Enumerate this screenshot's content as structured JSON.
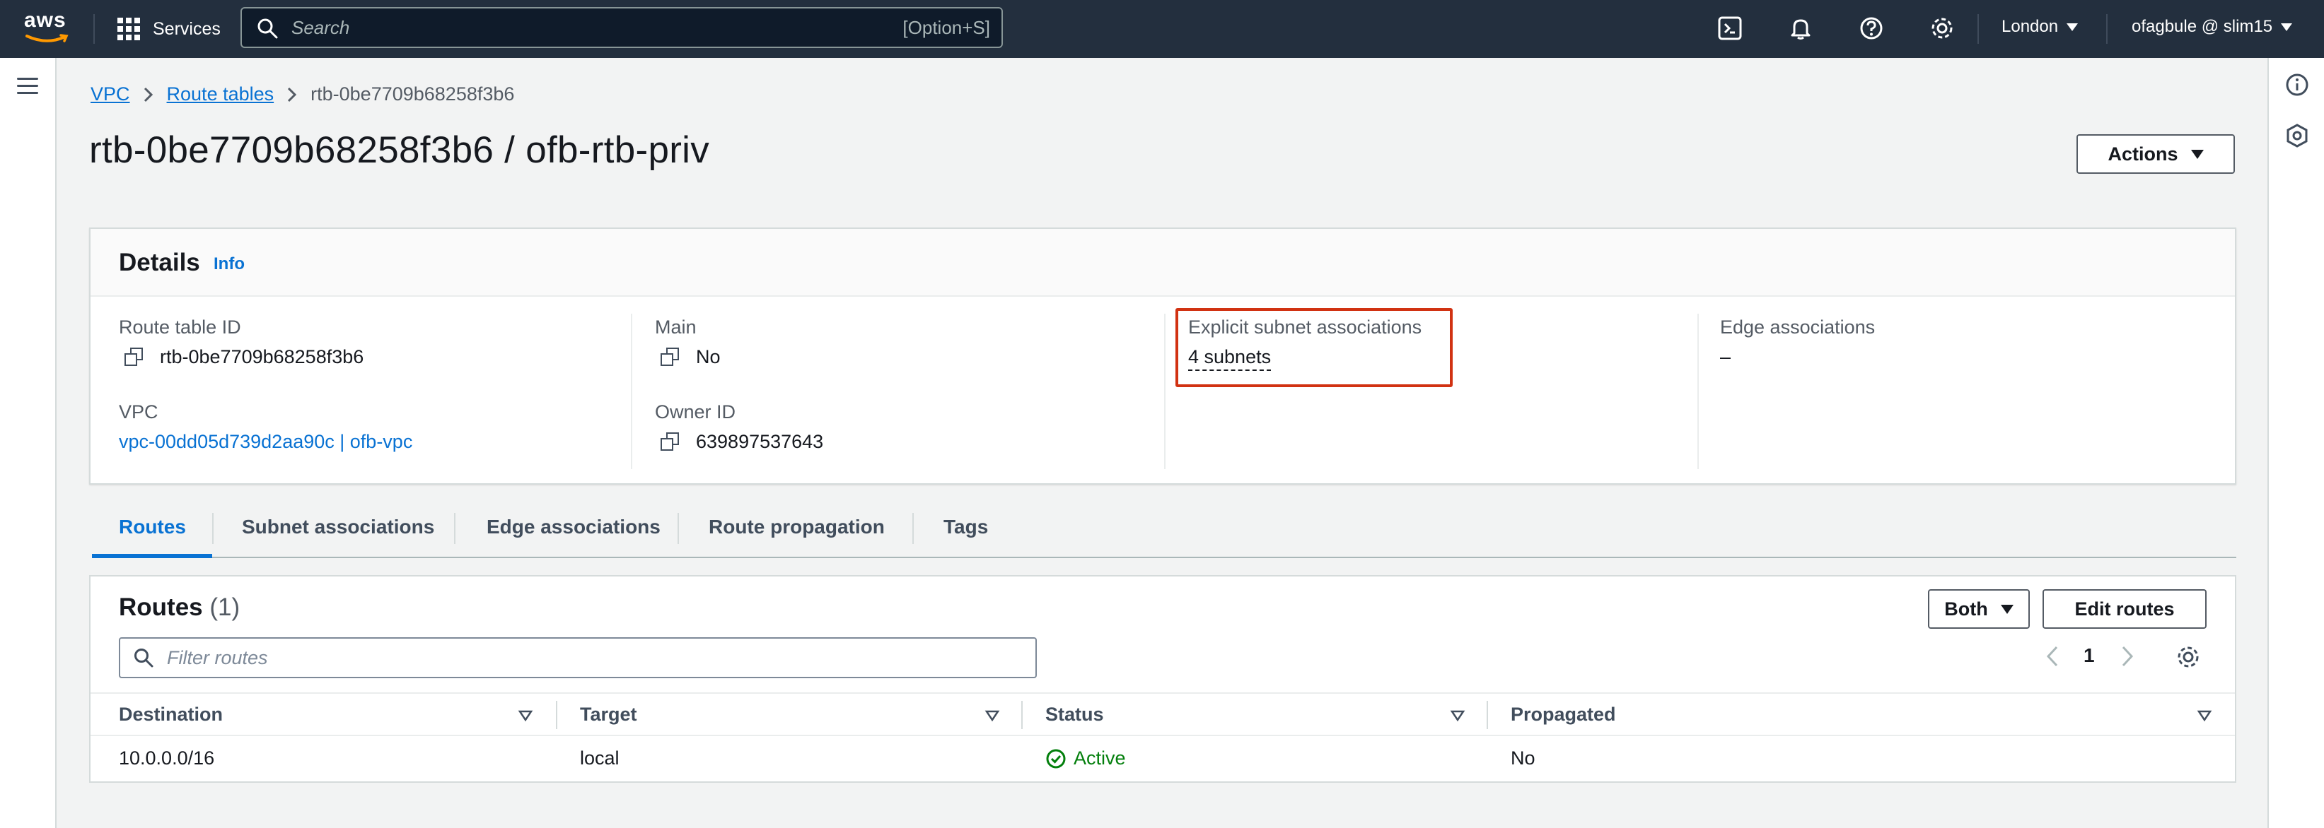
{
  "topnav": {
    "logo_text": "aws",
    "services_label": "Services",
    "search_placeholder": "Search",
    "search_shortcut": "[Option+S]",
    "region": "London",
    "account": "ofagbule @ slim15"
  },
  "breadcrumb": {
    "items": [
      "VPC",
      "Route tables"
    ],
    "current": "rtb-0be7709b68258f3b6"
  },
  "page_title": "rtb-0be7709b68258f3b6 / ofb-rtb-priv",
  "actions_label": "Actions",
  "details": {
    "title": "Details",
    "info_label": "Info",
    "route_table_id_label": "Route table ID",
    "route_table_id": "rtb-0be7709b68258f3b6",
    "vpc_label": "VPC",
    "vpc_value": "vpc-00dd05d739d2aa90c | ofb-vpc",
    "main_label": "Main",
    "main_value": "No",
    "owner_id_label": "Owner ID",
    "owner_id": "639897537643",
    "explicit_label": "Explicit subnet associations",
    "explicit_value": "4 subnets",
    "edge_label": "Edge associations",
    "edge_value": "–"
  },
  "tabs": [
    {
      "label": "Routes",
      "active": true
    },
    {
      "label": "Subnet associations",
      "active": false
    },
    {
      "label": "Edge associations",
      "active": false
    },
    {
      "label": "Route propagation",
      "active": false
    },
    {
      "label": "Tags",
      "active": false
    }
  ],
  "routes": {
    "title": "Routes",
    "count": "(1)",
    "filter_placeholder": "Filter routes",
    "view_select": "Both",
    "edit_label": "Edit routes",
    "page": "1",
    "columns": [
      "Destination",
      "Target",
      "Status",
      "Propagated"
    ],
    "rows": [
      {
        "destination": "10.0.0.0/16",
        "target": "local",
        "status": "Active",
        "propagated": "No"
      }
    ]
  },
  "colors": {
    "nav_bg": "#232f3e",
    "link": "#0972d3",
    "highlight": "#d13212",
    "status_ok": "#037f0c"
  }
}
